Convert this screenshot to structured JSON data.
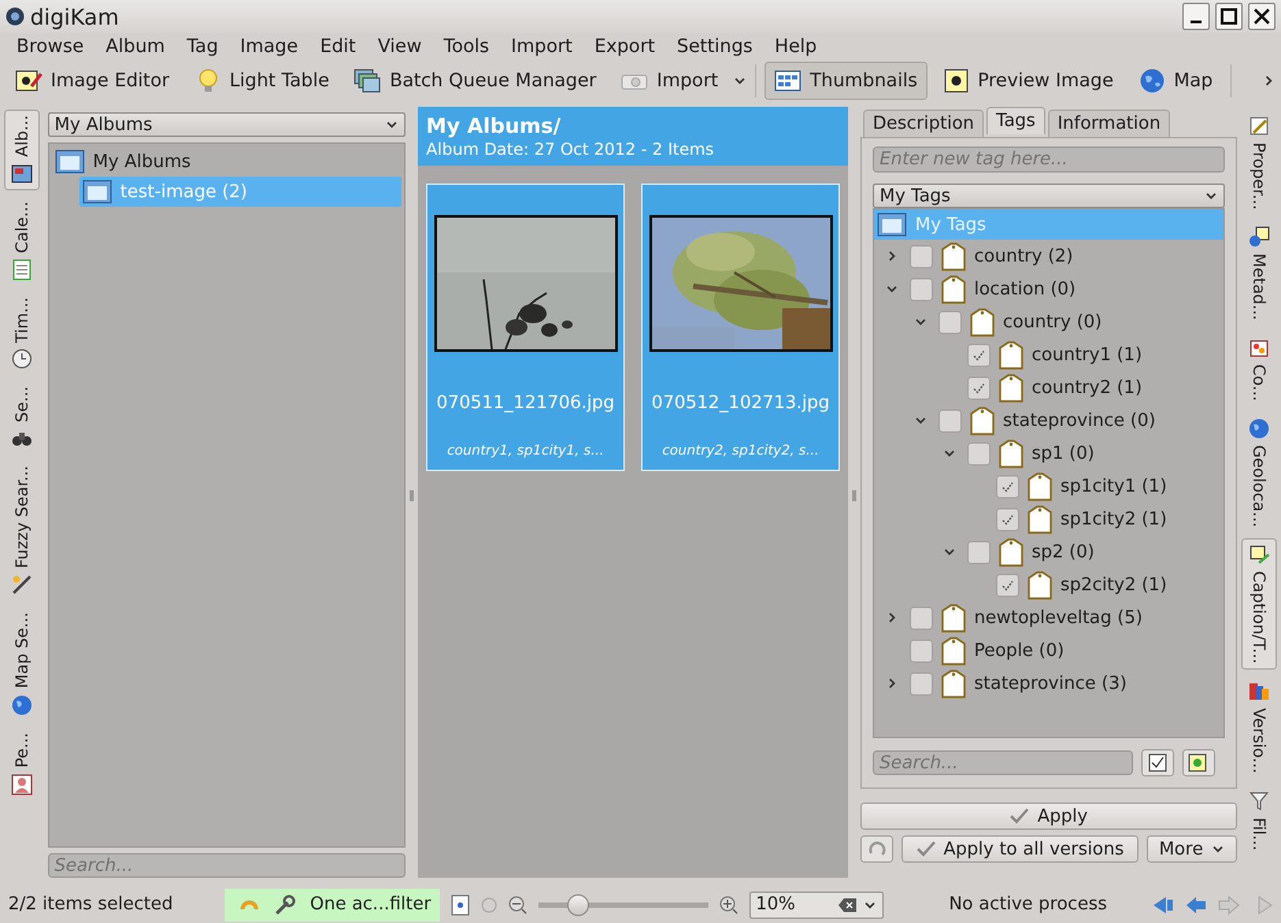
{
  "window": {
    "title": "digiKam"
  },
  "menu": [
    "Browse",
    "Album",
    "Tag",
    "Image",
    "Edit",
    "View",
    "Tools",
    "Import",
    "Export",
    "Settings",
    "Help"
  ],
  "toolbar": [
    {
      "label": "Image Editor",
      "kind": "editor",
      "selected": false
    },
    {
      "label": "Light Table",
      "kind": "lighttable",
      "selected": false
    },
    {
      "label": "Batch Queue Manager",
      "kind": "batch",
      "selected": false
    },
    {
      "label": "Import",
      "kind": "import",
      "selected": false
    },
    {
      "label": "Thumbnails",
      "kind": "thumbnails",
      "selected": true
    },
    {
      "label": "Preview Image",
      "kind": "preview",
      "selected": false
    },
    {
      "label": "Map",
      "kind": "map",
      "selected": false
    }
  ],
  "left_tabs": [
    {
      "label": "Alb...",
      "kind": "album",
      "selected": true
    },
    {
      "label": "Cale...",
      "kind": "calendar",
      "selected": false
    },
    {
      "label": "Tim...",
      "kind": "timeline",
      "selected": false
    },
    {
      "label": "Se...",
      "kind": "search",
      "selected": false
    },
    {
      "label": "Fuzzy Sear...",
      "kind": "fuzzy",
      "selected": false
    },
    {
      "label": "Map Se...",
      "kind": "map",
      "selected": false
    },
    {
      "label": "Pe...",
      "kind": "people",
      "selected": false
    }
  ],
  "albums_panel": {
    "dropdown": "My Albums",
    "tree": [
      {
        "label": "My Albums",
        "selected": false,
        "children": [
          {
            "label": "test-image (2)",
            "selected": true
          }
        ]
      }
    ],
    "search": {
      "placeholder": "Search..."
    }
  },
  "album_view": {
    "title": "My Albums/",
    "subtitle": "Album Date: 27 Oct 2012 - 2 Items",
    "items": [
      {
        "filename": "070511_121706.jpg",
        "tags": "country1, sp1city1, s...",
        "selected": true
      },
      {
        "filename": "070512_102713.jpg",
        "tags": "country2, sp1city2, s...",
        "selected": true
      }
    ]
  },
  "right_panel": {
    "tabs": [
      {
        "label": "Description",
        "selected": false
      },
      {
        "label": "Tags",
        "selected": true
      },
      {
        "label": "Information",
        "selected": false
      }
    ],
    "new_tag": {
      "placeholder": "Enter new tag here..."
    },
    "dropdown": "My Tags",
    "root": {
      "label": "My Tags",
      "selected": true
    },
    "tree": [
      {
        "label": "country (2)",
        "checked": false,
        "expanded": false
      },
      {
        "label": "location (0)",
        "checked": false,
        "expanded": true,
        "children": [
          {
            "label": "country (0)",
            "checked": false,
            "expanded": true,
            "children": [
              {
                "label": "country1 (1)",
                "checked": true
              },
              {
                "label": "country2 (1)",
                "checked": true
              }
            ]
          },
          {
            "label": "stateprovince (0)",
            "checked": false,
            "expanded": true,
            "children": [
              {
                "label": "sp1 (0)",
                "checked": false,
                "expanded": true,
                "children": [
                  {
                    "label": "sp1city1 (1)",
                    "checked": true
                  },
                  {
                    "label": "sp1city2 (1)",
                    "checked": true
                  }
                ]
              },
              {
                "label": "sp2 (0)",
                "checked": false,
                "expanded": true,
                "children": [
                  {
                    "label": "sp2city2 (1)",
                    "checked": true
                  }
                ]
              }
            ]
          }
        ]
      },
      {
        "label": "newtopleveltag (5)",
        "checked": false,
        "expanded": false
      },
      {
        "label": "People (0)",
        "checked": false
      },
      {
        "label": "stateprovince (3)",
        "checked": false,
        "expanded": false
      }
    ],
    "search": {
      "placeholder": "Search..."
    },
    "apply": "Apply",
    "apply_all": "Apply to all versions",
    "more": "More"
  },
  "right_tabs": [
    {
      "label": "Proper...",
      "kind": "properties",
      "selected": false
    },
    {
      "label": "Metad...",
      "kind": "metadata",
      "selected": false
    },
    {
      "label": "Co...",
      "kind": "colors",
      "selected": false
    },
    {
      "label": "Geoloca...",
      "kind": "geo",
      "selected": false
    },
    {
      "label": "Caption/T...",
      "kind": "caption",
      "selected": true
    },
    {
      "label": "Versio...",
      "kind": "versions",
      "selected": false
    },
    {
      "label": "Fil...",
      "kind": "filter",
      "selected": false
    }
  ],
  "status_bar": {
    "selection": "2/2 items selected",
    "filter": "One ac...filter",
    "zoom": {
      "level": 0.2,
      "value": "10%"
    },
    "process": "No active process"
  }
}
